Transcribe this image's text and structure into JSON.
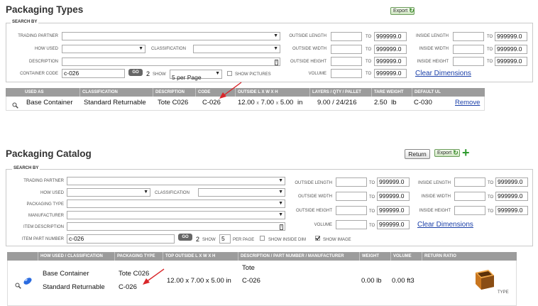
{
  "types": {
    "title": "Packaging Types",
    "export_label": "Export",
    "search_legend": "SEARCH BY",
    "labels": {
      "trading_partner": "TRADING PARTNER",
      "how_used": "HOW USED",
      "classification": "CLASSIFICATION",
      "description": "DESCRIPTION",
      "container_code": "CONTAINER CODE",
      "outside_length": "OUTSIDE LENGTH",
      "outside_width": "OUTSIDE WIDTH",
      "outside_height": "OUTSIDE HEIGHT",
      "volume": "VOLUME",
      "inside_length": "INSIDE LENGTH",
      "inside_width": "INSIDE WIDTH",
      "inside_height": "INSIDE HEIGHT",
      "to": "TO",
      "show": "SHOW",
      "show_pictures": "SHOW PICTURES"
    },
    "container_code_value": "c-026",
    "go_label": "GO",
    "count": "2",
    "per_page_value": "5 per Page",
    "max_value": "999999.0",
    "clear_dimensions": "Clear Dimensions",
    "columns": [
      "USED AS",
      "CLASSIFICATION",
      "DESCRIPTION",
      "CODE",
      "OUTSIDE L X W X H",
      "LAYERS / QTY / PALLET",
      "TARE WEIGHT",
      "DEFAULT UL"
    ],
    "row": {
      "used_as": "Base Container",
      "classification": "Standard Returnable",
      "description": "Tote C026",
      "code": "C-026",
      "dim_l": "12.00",
      "dim_w": "7.00",
      "dim_h": "5.00",
      "dim_unit": "in",
      "times": "x",
      "layers": "9.00",
      "qty": "24",
      "pallet": "216",
      "slash": "/",
      "tare_weight": "2.50",
      "tare_unit": "lb",
      "default_ul": "C-030",
      "remove": "Remove"
    }
  },
  "catalog": {
    "title": "Packaging Catalog",
    "return_label": "Return",
    "export_label": "Export",
    "search_legend": "SEARCH BY",
    "labels": {
      "trading_partner": "TRADING PARTNER",
      "how_used": "HOW USED",
      "classification": "CLASSIFICATION",
      "packaging_type": "PACKAGING TYPE",
      "manufacturer": "MANUFACTURER",
      "item_description": "ITEM DESCRIPTION",
      "item_part_number": "ITEM PART NUMBER",
      "outside_length": "OUTSIDE LENGTH",
      "outside_width": "OUTSIDE WIDTH",
      "outside_height": "OUTSIDE HEIGHT",
      "volume": "VOLUME",
      "inside_length": "INSIDE LENGTH",
      "inside_width": "INSIDE WIDTH",
      "inside_height": "INSIDE HEIGHT",
      "to": "TO",
      "show": "SHOW",
      "per_page": "PER PAGE",
      "show_inside_dim": "SHOW INSIDE DIM",
      "show_image": "SHOW IMAGE"
    },
    "part_number_value": "c-026",
    "go_label": "GO",
    "count": "2",
    "show_value": "5",
    "max_value": "999999.0",
    "clear_dimensions": "Clear Dimensions",
    "columns": [
      "HOW USED / CLASSIFICATION",
      "PACKAGING TYPE",
      "TOP OUTSIDE L X W X H",
      "DESCRIPTION / PART NUMBER / MANUFACTURER",
      "WEIGHT",
      "VOLUME",
      "RETURN RATIO"
    ],
    "row": {
      "how_used": "Base Container",
      "classification": "Standard Returnable",
      "packaging_type": "Tote C026",
      "packaging_code": "C-026",
      "dimensions": "12.00 x 7.00 x 5.00 in",
      "description": "Tote",
      "part_number": "C-026",
      "weight": "0.00 lb",
      "volume": "0.00 ft3",
      "type_label": "TYPE"
    }
  },
  "colors": {
    "header_bg": "#9c9c9c",
    "link": "#1a3fa8",
    "arrow": "#d9262a",
    "export_green": "#3a8a2a"
  }
}
